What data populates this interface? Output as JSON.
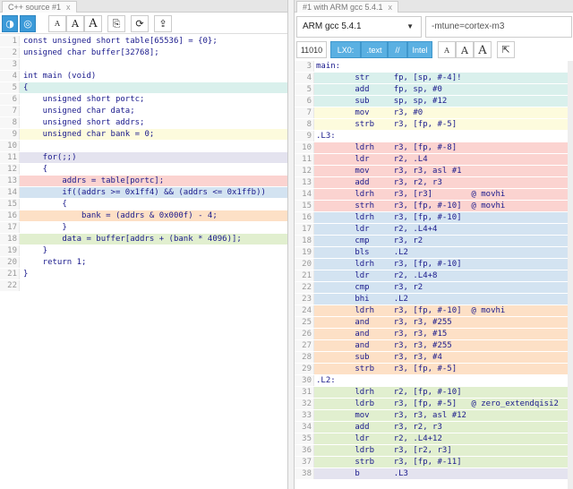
{
  "left": {
    "tab_title": "C++ source #1",
    "tab_close": "x",
    "toolbar": {
      "btn1": "◑",
      "btn2": "◎",
      "font_small": "A",
      "font_mid": "A",
      "font_large": "A",
      "save_icon": "⎘",
      "reload_icon": "⟳",
      "upload_icon": "⇪"
    },
    "lines": [
      {
        "n": "1",
        "t": "const unsigned short table[65536] = {0};",
        "c": ""
      },
      {
        "n": "2",
        "t": "unsigned char buffer[32768];",
        "c": ""
      },
      {
        "n": "3",
        "t": "",
        "c": ""
      },
      {
        "n": "4",
        "t": "int main (void)",
        "c": ""
      },
      {
        "n": "5",
        "t": "{",
        "c": "teal"
      },
      {
        "n": "6",
        "t": "    unsigned short portc;",
        "c": ""
      },
      {
        "n": "7",
        "t": "    unsigned char data;",
        "c": ""
      },
      {
        "n": "8",
        "t": "    unsigned short addrs;",
        "c": ""
      },
      {
        "n": "9",
        "t": "    unsigned char bank = 0;",
        "c": "yellow"
      },
      {
        "n": "10",
        "t": "",
        "c": ""
      },
      {
        "n": "11",
        "t": "    for(;;)",
        "c": "purple"
      },
      {
        "n": "12",
        "t": "    {",
        "c": ""
      },
      {
        "n": "13",
        "t": "        addrs = table[portc];",
        "c": "red"
      },
      {
        "n": "14",
        "t": "        if((addrs >= 0x1ff4) && (addrs <= 0x1ffb))",
        "c": "blue"
      },
      {
        "n": "15",
        "t": "        {",
        "c": ""
      },
      {
        "n": "16",
        "t": "            bank = (addrs & 0x000f) - 4;",
        "c": "orange"
      },
      {
        "n": "17",
        "t": "        }",
        "c": ""
      },
      {
        "n": "18",
        "t": "        data = buffer[addrs + (bank * 4096)];",
        "c": "green"
      },
      {
        "n": "19",
        "t": "    }",
        "c": ""
      },
      {
        "n": "20",
        "t": "    return 1;",
        "c": ""
      },
      {
        "n": "21",
        "t": "}",
        "c": ""
      },
      {
        "n": "22",
        "t": "",
        "c": ""
      }
    ]
  },
  "right": {
    "tab_title": "#1 with ARM gcc 5.4.1",
    "tab_close": "x",
    "compiler": "ARM gcc 5.4.1",
    "caret": "▼",
    "options": "-mtune=cortex-m3",
    "filters": {
      "binary": "11010",
      "labels": "LX0:",
      "directives": ".text",
      "comments": "//",
      "intel": "Intel",
      "font_small": "A",
      "font_mid": "A",
      "font_large": "A",
      "popout": "⇱"
    },
    "lines": [
      {
        "n": "3",
        "t": "main:",
        "c": ""
      },
      {
        "n": "4",
        "t": "        str     fp, [sp, #-4]!",
        "c": "teal"
      },
      {
        "n": "5",
        "t": "        add     fp, sp, #0",
        "c": "teal"
      },
      {
        "n": "6",
        "t": "        sub     sp, sp, #12",
        "c": "teal"
      },
      {
        "n": "7",
        "t": "        mov     r3, #0",
        "c": "yellow"
      },
      {
        "n": "8",
        "t": "        strb    r3, [fp, #-5]",
        "c": "yellow"
      },
      {
        "n": "9",
        "t": ".L3:",
        "c": ""
      },
      {
        "n": "10",
        "t": "        ldrh    r3, [fp, #-8]",
        "c": "red"
      },
      {
        "n": "11",
        "t": "        ldr     r2, .L4",
        "c": "red"
      },
      {
        "n": "12",
        "t": "        mov     r3, r3, asl #1",
        "c": "red"
      },
      {
        "n": "13",
        "t": "        add     r3, r2, r3",
        "c": "red"
      },
      {
        "n": "14",
        "t": "        ldrh    r3, [r3]        @ movhi",
        "c": "red"
      },
      {
        "n": "15",
        "t": "        strh    r3, [fp, #-10]  @ movhi",
        "c": "red"
      },
      {
        "n": "16",
        "t": "        ldrh    r3, [fp, #-10]",
        "c": "blue"
      },
      {
        "n": "17",
        "t": "        ldr     r2, .L4+4",
        "c": "blue"
      },
      {
        "n": "18",
        "t": "        cmp     r3, r2",
        "c": "blue"
      },
      {
        "n": "19",
        "t": "        bls     .L2",
        "c": "blue"
      },
      {
        "n": "20",
        "t": "        ldrh    r3, [fp, #-10]",
        "c": "blue"
      },
      {
        "n": "21",
        "t": "        ldr     r2, .L4+8",
        "c": "blue"
      },
      {
        "n": "22",
        "t": "        cmp     r3, r2",
        "c": "blue"
      },
      {
        "n": "23",
        "t": "        bhi     .L2",
        "c": "blue"
      },
      {
        "n": "24",
        "t": "        ldrh    r3, [fp, #-10]  @ movhi",
        "c": "orange"
      },
      {
        "n": "25",
        "t": "        and     r3, r3, #255",
        "c": "orange"
      },
      {
        "n": "26",
        "t": "        and     r3, r3, #15",
        "c": "orange"
      },
      {
        "n": "27",
        "t": "        and     r3, r3, #255",
        "c": "orange"
      },
      {
        "n": "28",
        "t": "        sub     r3, r3, #4",
        "c": "orange"
      },
      {
        "n": "29",
        "t": "        strb    r3, [fp, #-5]",
        "c": "orange"
      },
      {
        "n": "30",
        "t": ".L2:",
        "c": ""
      },
      {
        "n": "31",
        "t": "        ldrh    r2, [fp, #-10]",
        "c": "green"
      },
      {
        "n": "32",
        "t": "        ldrb    r3, [fp, #-5]   @ zero_extendqisi2",
        "c": "green"
      },
      {
        "n": "33",
        "t": "        mov     r3, r3, asl #12",
        "c": "green"
      },
      {
        "n": "34",
        "t": "        add     r3, r2, r3",
        "c": "green"
      },
      {
        "n": "35",
        "t": "        ldr     r2, .L4+12",
        "c": "green"
      },
      {
        "n": "36",
        "t": "        ldrb    r3, [r2, r3]",
        "c": "green"
      },
      {
        "n": "37",
        "t": "        strb    r3, [fp, #-11]",
        "c": "green"
      },
      {
        "n": "38",
        "t": "        b       .L3",
        "c": "purple"
      }
    ]
  }
}
